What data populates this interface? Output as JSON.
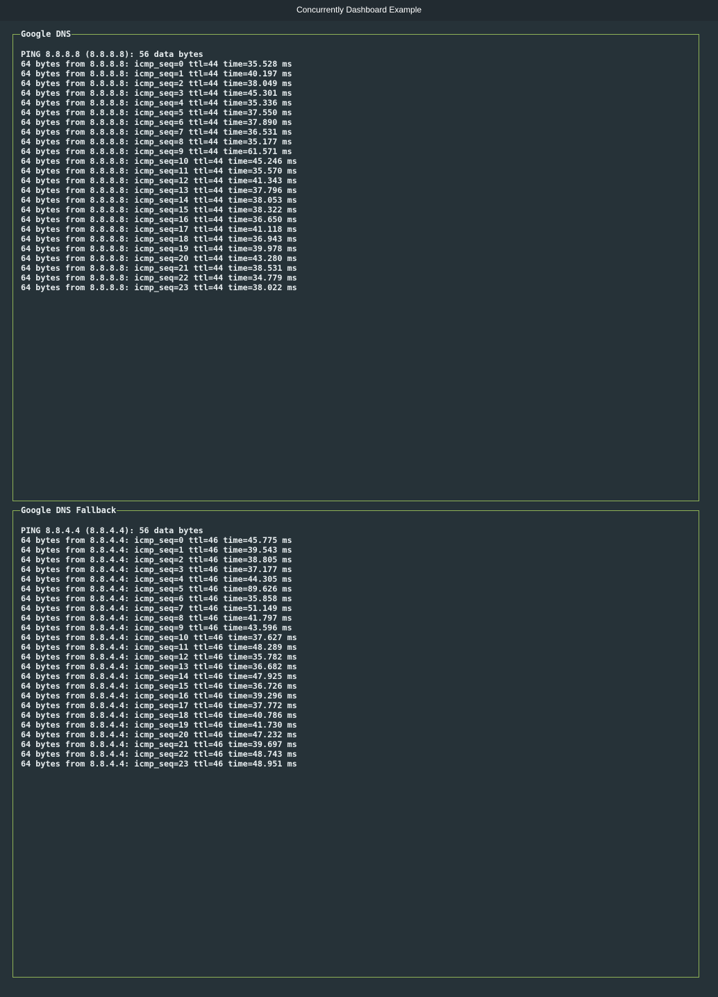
{
  "window": {
    "title": "Concurrently Dashboard Example"
  },
  "colors": {
    "background": "#263238",
    "border": "#8fb257",
    "text": "#e8eef0",
    "titlebar": "#222b31"
  },
  "panels": [
    {
      "label": "Google DNS",
      "lines": [
        "PING 8.8.8.8 (8.8.8.8): 56 data bytes",
        "64 bytes from 8.8.8.8: icmp_seq=0 ttl=44 time=35.528 ms",
        "64 bytes from 8.8.8.8: icmp_seq=1 ttl=44 time=40.197 ms",
        "64 bytes from 8.8.8.8: icmp_seq=2 ttl=44 time=38.049 ms",
        "64 bytes from 8.8.8.8: icmp_seq=3 ttl=44 time=45.301 ms",
        "64 bytes from 8.8.8.8: icmp_seq=4 ttl=44 time=35.336 ms",
        "64 bytes from 8.8.8.8: icmp_seq=5 ttl=44 time=37.550 ms",
        "64 bytes from 8.8.8.8: icmp_seq=6 ttl=44 time=37.890 ms",
        "64 bytes from 8.8.8.8: icmp_seq=7 ttl=44 time=36.531 ms",
        "64 bytes from 8.8.8.8: icmp_seq=8 ttl=44 time=35.177 ms",
        "64 bytes from 8.8.8.8: icmp_seq=9 ttl=44 time=61.571 ms",
        "64 bytes from 8.8.8.8: icmp_seq=10 ttl=44 time=45.246 ms",
        "64 bytes from 8.8.8.8: icmp_seq=11 ttl=44 time=35.570 ms",
        "64 bytes from 8.8.8.8: icmp_seq=12 ttl=44 time=41.343 ms",
        "64 bytes from 8.8.8.8: icmp_seq=13 ttl=44 time=37.796 ms",
        "64 bytes from 8.8.8.8: icmp_seq=14 ttl=44 time=38.053 ms",
        "64 bytes from 8.8.8.8: icmp_seq=15 ttl=44 time=38.322 ms",
        "64 bytes from 8.8.8.8: icmp_seq=16 ttl=44 time=36.650 ms",
        "64 bytes from 8.8.8.8: icmp_seq=17 ttl=44 time=41.118 ms",
        "64 bytes from 8.8.8.8: icmp_seq=18 ttl=44 time=36.943 ms",
        "64 bytes from 8.8.8.8: icmp_seq=19 ttl=44 time=39.978 ms",
        "64 bytes from 8.8.8.8: icmp_seq=20 ttl=44 time=43.280 ms",
        "64 bytes from 8.8.8.8: icmp_seq=21 ttl=44 time=38.531 ms",
        "64 bytes from 8.8.8.8: icmp_seq=22 ttl=44 time=34.779 ms",
        "64 bytes from 8.8.8.8: icmp_seq=23 ttl=44 time=38.022 ms"
      ]
    },
    {
      "label": "Google DNS Fallback",
      "lines": [
        "PING 8.8.4.4 (8.8.4.4): 56 data bytes",
        "64 bytes from 8.8.4.4: icmp_seq=0 ttl=46 time=45.775 ms",
        "64 bytes from 8.8.4.4: icmp_seq=1 ttl=46 time=39.543 ms",
        "64 bytes from 8.8.4.4: icmp_seq=2 ttl=46 time=38.805 ms",
        "64 bytes from 8.8.4.4: icmp_seq=3 ttl=46 time=37.177 ms",
        "64 bytes from 8.8.4.4: icmp_seq=4 ttl=46 time=44.305 ms",
        "64 bytes from 8.8.4.4: icmp_seq=5 ttl=46 time=89.626 ms",
        "64 bytes from 8.8.4.4: icmp_seq=6 ttl=46 time=35.858 ms",
        "64 bytes from 8.8.4.4: icmp_seq=7 ttl=46 time=51.149 ms",
        "64 bytes from 8.8.4.4: icmp_seq=8 ttl=46 time=41.797 ms",
        "64 bytes from 8.8.4.4: icmp_seq=9 ttl=46 time=43.596 ms",
        "64 bytes from 8.8.4.4: icmp_seq=10 ttl=46 time=37.627 ms",
        "64 bytes from 8.8.4.4: icmp_seq=11 ttl=46 time=48.289 ms",
        "64 bytes from 8.8.4.4: icmp_seq=12 ttl=46 time=35.782 ms",
        "64 bytes from 8.8.4.4: icmp_seq=13 ttl=46 time=36.682 ms",
        "64 bytes from 8.8.4.4: icmp_seq=14 ttl=46 time=47.925 ms",
        "64 bytes from 8.8.4.4: icmp_seq=15 ttl=46 time=36.726 ms",
        "64 bytes from 8.8.4.4: icmp_seq=16 ttl=46 time=39.296 ms",
        "64 bytes from 8.8.4.4: icmp_seq=17 ttl=46 time=37.772 ms",
        "64 bytes from 8.8.4.4: icmp_seq=18 ttl=46 time=40.786 ms",
        "64 bytes from 8.8.4.4: icmp_seq=19 ttl=46 time=41.730 ms",
        "64 bytes from 8.8.4.4: icmp_seq=20 ttl=46 time=47.232 ms",
        "64 bytes from 8.8.4.4: icmp_seq=21 ttl=46 time=39.697 ms",
        "64 bytes from 8.8.4.4: icmp_seq=22 ttl=46 time=48.743 ms",
        "64 bytes from 8.8.4.4: icmp_seq=23 ttl=46 time=48.951 ms"
      ]
    }
  ]
}
